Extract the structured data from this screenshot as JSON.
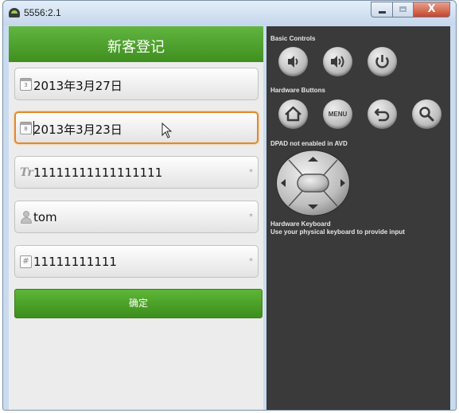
{
  "window": {
    "title": "5556:2.1",
    "close_glyph": "X"
  },
  "app": {
    "header_title": "新客登记",
    "fields": [
      {
        "icon": "calendar-icon",
        "icon_text": "3",
        "value": "2013年3月27日"
      },
      {
        "icon": "calendar-icon",
        "icon_text": "8",
        "value": "2013年3月23日"
      },
      {
        "icon": "text-field-icon",
        "icon_text": "Tr",
        "value": "11111111111111111",
        "required": "*"
      },
      {
        "icon": "user-icon",
        "value": "tom",
        "required": "*"
      },
      {
        "icon": "number-icon",
        "icon_text": "#",
        "value": "11111111111",
        "required": "*"
      }
    ],
    "confirm_label": "确定"
  },
  "controls": {
    "basic_label": "Basic Controls",
    "basic_buttons": [
      "volume-down-icon",
      "volume-up-icon",
      "power-icon"
    ],
    "hardware_label": "Hardware Buttons",
    "hardware_buttons": [
      "home-icon",
      "menu-button",
      "back-icon",
      "search-icon"
    ],
    "menu_label": "MENU",
    "dpad_label": "DPAD not enabled in AVD",
    "keyboard_title": "Hardware Keyboard",
    "keyboard_hint": "Use your physical keyboard to provide input"
  },
  "colors": {
    "accent_green": "#4fa52c",
    "focus_orange": "#e28a2b",
    "panel_dark": "#3a3a3a"
  }
}
